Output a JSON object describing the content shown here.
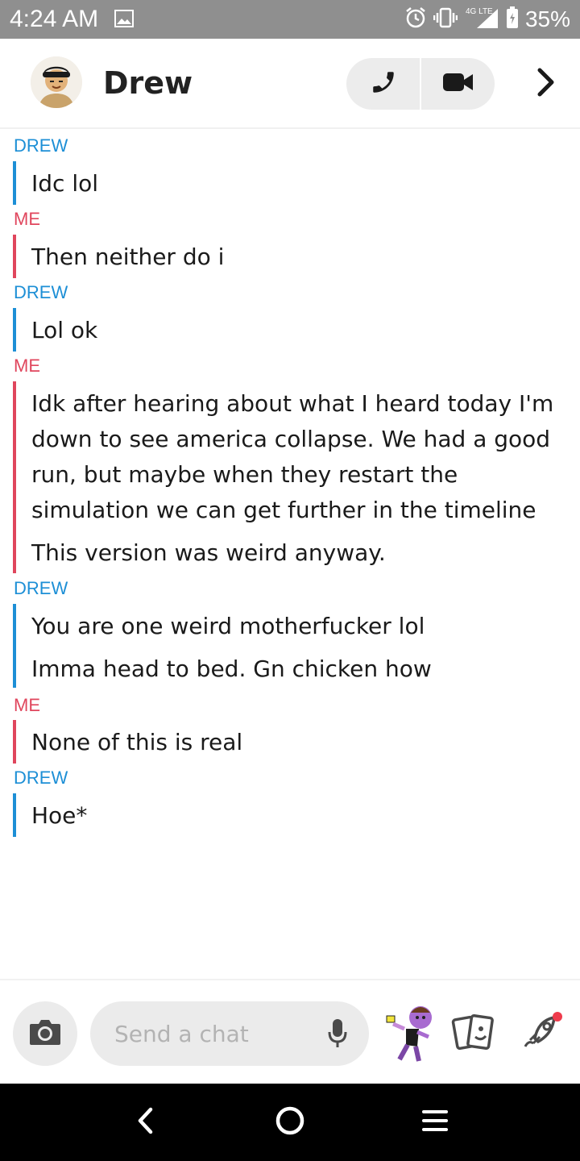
{
  "status_bar": {
    "time": "4:24 AM",
    "network": "4G LTE",
    "battery": "35%",
    "icons": [
      "gallery-icon",
      "alarm-icon",
      "vibrate-icon",
      "signal-icon",
      "battery-icon"
    ]
  },
  "header": {
    "contact_name": "Drew",
    "icons": [
      "avatar",
      "phone-icon",
      "video-icon",
      "chevron-right-icon"
    ]
  },
  "messages": [
    {
      "sender": "DREW",
      "lines": [
        "Idc lol"
      ]
    },
    {
      "sender": "ME",
      "lines": [
        "Then neither do i"
      ]
    },
    {
      "sender": "DREW",
      "lines": [
        "Lol ok"
      ]
    },
    {
      "sender": "ME",
      "lines": [
        "Idk after hearing about what I heard today I'm down to see america collapse. We had a good run, but maybe when they restart the simulation we can get further in the timeline",
        "This version was weird anyway."
      ]
    },
    {
      "sender": "DREW",
      "lines": [
        "You are one weird motherfucker lol",
        "Imma head to bed. Gn chicken how"
      ]
    },
    {
      "sender": "ME",
      "lines": [
        "None of this is real"
      ]
    },
    {
      "sender": "DREW",
      "lines": [
        "Hoe*"
      ]
    }
  ],
  "input_bar": {
    "placeholder": "Send a chat",
    "icons": [
      "camera-icon",
      "microphone-icon",
      "bitmoji-icon",
      "cards-icon",
      "rocket-icon"
    ]
  },
  "nav_bar": {
    "icons": [
      "back-icon",
      "home-icon",
      "recents-icon"
    ]
  },
  "colors": {
    "friend": "#1d8fd6",
    "me": "#e0465d",
    "status_bar": "#8f8f8f"
  }
}
